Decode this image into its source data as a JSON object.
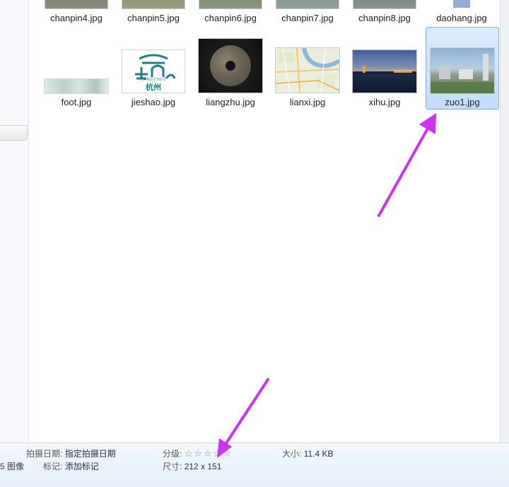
{
  "files_top_row": [
    {
      "name": "chanpin4.jpg"
    },
    {
      "name": "chanpin5.jpg"
    },
    {
      "name": "chanpin6.jpg"
    },
    {
      "name": "chanpin7.jpg"
    },
    {
      "name": "chanpin8.jpg"
    },
    {
      "name": "daohang.jpg"
    }
  ],
  "files_second_row": [
    {
      "name": "foot.jpg"
    },
    {
      "name": "jieshao.jpg"
    },
    {
      "name": "liangzhu.jpg"
    },
    {
      "name": "lianxi.jpg"
    },
    {
      "name": "xihu.jpg"
    },
    {
      "name": "zuo1.jpg",
      "selected": true
    }
  ],
  "jieshao_logo": {
    "city_cn": "杭州",
    "city_en": "HANGZHOU"
  },
  "details": {
    "item_count_suffix": "5 图像",
    "date_taken_label": "拍摄日期:",
    "date_taken_value": "指定拍摄日期",
    "tags_label": "标记:",
    "tags_value": "添加标记",
    "rating_label": "分级:",
    "rating_stars": 5,
    "rating_value": 0,
    "dimensions_label": "尺寸:",
    "dimensions_value": "212 x 151",
    "size_label": "大小:",
    "size_value": "11.4 KB"
  },
  "colors": {
    "arrow": "#cc33ee",
    "selection_bg": "#cfe3fb",
    "selection_border": "#84acdd"
  }
}
